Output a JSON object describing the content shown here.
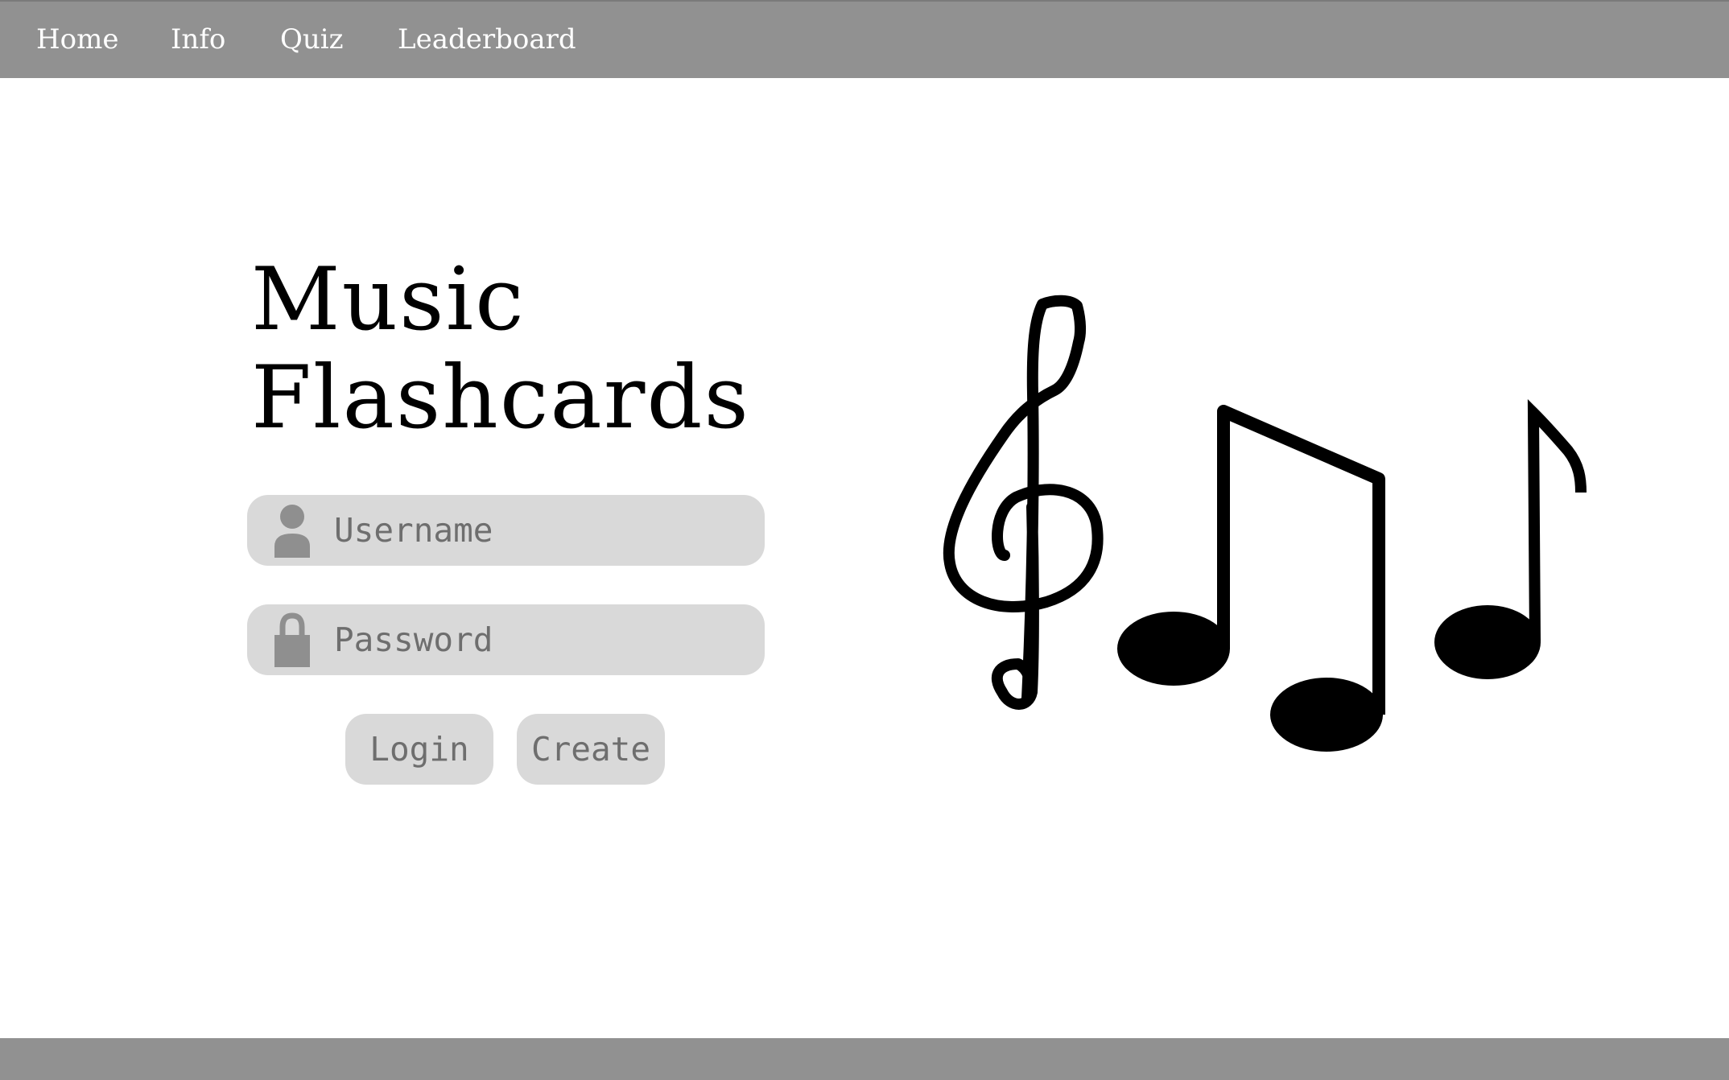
{
  "nav": {
    "items": [
      {
        "label": "Home"
      },
      {
        "label": "Info"
      },
      {
        "label": "Quiz"
      },
      {
        "label": "Leaderboard"
      }
    ]
  },
  "hero": {
    "title_line1": "Music",
    "title_line2": "Flashcards"
  },
  "form": {
    "username": {
      "value": "",
      "placeholder": "Username",
      "icon": "user-icon"
    },
    "password": {
      "value": "",
      "placeholder": "Password",
      "icon": "lock-icon"
    },
    "login_label": "Login",
    "create_label": "Create"
  },
  "illustration": {
    "icons": [
      "treble-clef-icon",
      "beamed-eighth-notes-icon",
      "eighth-note-icon"
    ]
  },
  "colors": {
    "nav_background": "#919191",
    "field_background": "#d9d9d9",
    "placeholder_text": "#6e6e6e",
    "icon_gray": "#8f8f8f"
  }
}
